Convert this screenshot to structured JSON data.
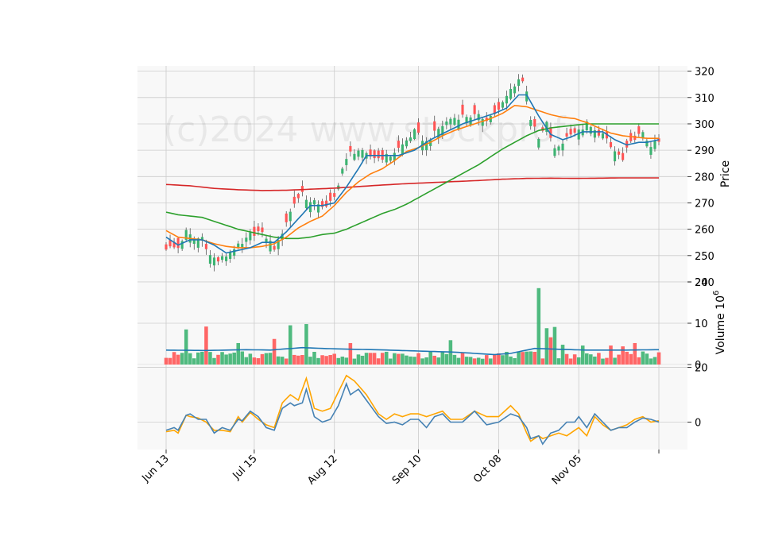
{
  "chart_data": {
    "type": "candlestick",
    "watermark": "(c)2024 www.stockprof",
    "x_tick_labels": [
      "Jun 13",
      "Jul 15",
      "Aug 12",
      "Sep 10",
      "Oct 08",
      "Nov 05",
      ""
    ],
    "x_tick_index": [
      0,
      22,
      42,
      63,
      83,
      103,
      123
    ],
    "colors": {
      "up": "#3cb371",
      "down": "#ff5555",
      "ma_short": "#1f77b4",
      "ma_mid": "#ff7f0e",
      "ma_long": "#2ca02c",
      "ma_200": "#d62728",
      "vol_avg": "#1f77b4",
      "osc_1": "#4682b4",
      "osc_2": "#ffa500",
      "panel_bg": "#f8f8f8",
      "grid": "#cccccc"
    },
    "price_panel": {
      "ylabel": "Price",
      "ylim": [
        240,
        322
      ],
      "yticks": [
        240,
        250,
        260,
        270,
        280,
        290,
        300,
        310,
        320
      ],
      "ohlc_anchors": [
        [
          0,
          253
        ],
        [
          3,
          253
        ],
        [
          5,
          259
        ],
        [
          7,
          256
        ],
        [
          9,
          257
        ],
        [
          11,
          250
        ],
        [
          13,
          248
        ],
        [
          15,
          250
        ],
        [
          17,
          253
        ],
        [
          19,
          254
        ],
        [
          21,
          258
        ],
        [
          23,
          259
        ],
        [
          25,
          257
        ],
        [
          27,
          253
        ],
        [
          28,
          255
        ],
        [
          30,
          263
        ],
        [
          32,
          270
        ],
        [
          34,
          274
        ],
        [
          36,
          270
        ],
        [
          38,
          270
        ],
        [
          40,
          268
        ],
        [
          42,
          272
        ],
        [
          44,
          283
        ],
        [
          46,
          289
        ],
        [
          48,
          290
        ],
        [
          50,
          288
        ],
        [
          53,
          287
        ],
        [
          56,
          288
        ],
        [
          59,
          292
        ],
        [
          62,
          297
        ],
        [
          65,
          293
        ],
        [
          68,
          298
        ],
        [
          71,
          302
        ],
        [
          74,
          303
        ],
        [
          77,
          303
        ],
        [
          80,
          302
        ],
        [
          83,
          305
        ],
        [
          86,
          313
        ],
        [
          88,
          317
        ],
        [
          89,
          316
        ],
        [
          90,
          313
        ],
        [
          91,
          302
        ],
        [
          93,
          294
        ],
        [
          95,
          300
        ],
        [
          97,
          290
        ],
        [
          99,
          293
        ],
        [
          101,
          297
        ],
        [
          103,
          297
        ],
        [
          105,
          300
        ],
        [
          107,
          297
        ],
        [
          109,
          296
        ],
        [
          111,
          291
        ],
        [
          113,
          288
        ],
        [
          114,
          286
        ],
        [
          115,
          290
        ],
        [
          117,
          295
        ],
        [
          119,
          296
        ],
        [
          121,
          292
        ],
        [
          123,
          293
        ]
      ],
      "ma_short_anchors": [
        [
          0,
          257
        ],
        [
          3,
          254
        ],
        [
          6,
          256
        ],
        [
          9,
          256
        ],
        [
          12,
          254
        ],
        [
          15,
          251
        ],
        [
          18,
          252
        ],
        [
          21,
          253
        ],
        [
          24,
          255
        ],
        [
          27,
          255
        ],
        [
          30,
          259
        ],
        [
          33,
          264
        ],
        [
          36,
          269
        ],
        [
          39,
          269
        ],
        [
          42,
          270
        ],
        [
          45,
          276
        ],
        [
          48,
          283
        ],
        [
          50,
          288
        ],
        [
          54,
          288
        ],
        [
          58,
          288
        ],
        [
          62,
          290
        ],
        [
          66,
          294
        ],
        [
          70,
          297
        ],
        [
          74,
          300
        ],
        [
          78,
          302
        ],
        [
          82,
          304
        ],
        [
          85,
          306
        ],
        [
          88,
          311
        ],
        [
          90,
          311
        ],
        [
          93,
          303
        ],
        [
          96,
          296
        ],
        [
          99,
          294
        ],
        [
          101,
          295
        ],
        [
          104,
          297
        ],
        [
          106,
          297
        ],
        [
          109,
          297
        ],
        [
          112,
          294
        ],
        [
          115,
          292
        ],
        [
          118,
          293
        ],
        [
          120,
          293
        ],
        [
          123,
          294
        ]
      ],
      "ma_mid_anchors": [
        [
          0,
          259.5
        ],
        [
          3,
          257
        ],
        [
          6,
          256.5
        ],
        [
          9,
          256
        ],
        [
          12,
          254.5
        ],
        [
          15,
          253.5
        ],
        [
          18,
          253
        ],
        [
          21,
          253
        ],
        [
          24,
          253.5
        ],
        [
          27,
          254.5
        ],
        [
          30,
          257
        ],
        [
          33,
          260.5
        ],
        [
          36,
          263
        ],
        [
          39,
          265
        ],
        [
          42,
          269
        ],
        [
          45,
          274
        ],
        [
          48,
          278
        ],
        [
          51,
          281
        ],
        [
          54,
          283
        ],
        [
          57,
          286
        ],
        [
          60,
          289.5
        ],
        [
          63,
          291
        ],
        [
          66,
          293
        ],
        [
          69,
          295.5
        ],
        [
          72,
          297.5
        ],
        [
          75,
          299
        ],
        [
          78,
          300.5
        ],
        [
          81,
          302
        ],
        [
          84,
          304
        ],
        [
          87,
          307
        ],
        [
          90,
          306.5
        ],
        [
          93,
          305
        ],
        [
          96,
          303.5
        ],
        [
          99,
          302.5
        ],
        [
          102,
          302
        ],
        [
          105,
          300.5
        ],
        [
          108,
          298.5
        ],
        [
          111,
          296.5
        ],
        [
          114,
          295.5
        ],
        [
          117,
          295
        ],
        [
          120,
          294.5
        ],
        [
          123,
          294.5
        ]
      ],
      "ma_long_anchors": [
        [
          0,
          266.5
        ],
        [
          3,
          265.5
        ],
        [
          6,
          265
        ],
        [
          9,
          264.5
        ],
        [
          12,
          263
        ],
        [
          15,
          261.5
        ],
        [
          18,
          260
        ],
        [
          21,
          259
        ],
        [
          24,
          258
        ],
        [
          27,
          257
        ],
        [
          30,
          256.5
        ],
        [
          33,
          256.5
        ],
        [
          36,
          257
        ],
        [
          39,
          258
        ],
        [
          42,
          258.5
        ],
        [
          45,
          260
        ],
        [
          48,
          262
        ],
        [
          51,
          264
        ],
        [
          54,
          266
        ],
        [
          57,
          267.5
        ],
        [
          60,
          269.5
        ],
        [
          63,
          272
        ],
        [
          66,
          274.5
        ],
        [
          69,
          277
        ],
        [
          72,
          279.5
        ],
        [
          75,
          282
        ],
        [
          78,
          284.5
        ],
        [
          81,
          287.5
        ],
        [
          84,
          290.5
        ],
        [
          87,
          293
        ],
        [
          90,
          295.5
        ],
        [
          93,
          297.5
        ],
        [
          96,
          298.5
        ],
        [
          99,
          299
        ],
        [
          102,
          299.5
        ],
        [
          105,
          300
        ],
        [
          108,
          300
        ],
        [
          111,
          300
        ],
        [
          114,
          300
        ],
        [
          117,
          300
        ],
        [
          120,
          300
        ],
        [
          123,
          300
        ]
      ],
      "ma_200_anchors": [
        [
          0,
          277
        ],
        [
          6,
          276.5
        ],
        [
          12,
          275.5
        ],
        [
          18,
          275
        ],
        [
          24,
          274.7
        ],
        [
          30,
          274.8
        ],
        [
          36,
          275.2
        ],
        [
          42,
          275.6
        ],
        [
          48,
          276.2
        ],
        [
          54,
          276.8
        ],
        [
          60,
          277.3
        ],
        [
          66,
          277.7
        ],
        [
          72,
          278.1
        ],
        [
          78,
          278.5
        ],
        [
          84,
          279
        ],
        [
          90,
          279.3
        ],
        [
          96,
          279.4
        ],
        [
          102,
          279.3
        ],
        [
          108,
          279.4
        ],
        [
          114,
          279.5
        ],
        [
          123,
          279.5
        ]
      ]
    },
    "volume_panel": {
      "ylabel": "Volume  10^6",
      "ylim": [
        0,
        20
      ],
      "yticks": [
        0,
        10,
        20
      ],
      "avg_anchors": [
        [
          0,
          3.5
        ],
        [
          10,
          3.4
        ],
        [
          20,
          3.6
        ],
        [
          26,
          3.5
        ],
        [
          34,
          4.1
        ],
        [
          42,
          3.8
        ],
        [
          52,
          3.6
        ],
        [
          62,
          3.3
        ],
        [
          72,
          3.0
        ],
        [
          82,
          2.4
        ],
        [
          86,
          2.7
        ],
        [
          92,
          3.9
        ],
        [
          98,
          3.7
        ],
        [
          105,
          3.5
        ],
        [
          115,
          3.5
        ],
        [
          123,
          3.6
        ]
      ],
      "spikes": [
        [
          5,
          8.5
        ],
        [
          10,
          9.2
        ],
        [
          18,
          5.2
        ],
        [
          27,
          6.2
        ],
        [
          31,
          9.5
        ],
        [
          35,
          9.8
        ],
        [
          46,
          5.2
        ],
        [
          71,
          5.9
        ],
        [
          93,
          18.5
        ],
        [
          95,
          8.8
        ],
        [
          96,
          6.6
        ],
        [
          97,
          9.1
        ],
        [
          99,
          4.8
        ],
        [
          104,
          4.6
        ],
        [
          111,
          4.6
        ],
        [
          114,
          4.4
        ],
        [
          117,
          5.2
        ]
      ]
    },
    "oscillator_panel": {
      "ylim": [
        -10,
        21
      ],
      "yticks": [
        0,
        20
      ],
      "series_1_anchors": [
        [
          0,
          -3
        ],
        [
          2,
          -2
        ],
        [
          3,
          -3
        ],
        [
          5,
          2.5
        ],
        [
          6,
          3
        ],
        [
          8,
          1
        ],
        [
          10,
          1
        ],
        [
          12,
          -4
        ],
        [
          14,
          -2
        ],
        [
          16,
          -3
        ],
        [
          18,
          1
        ],
        [
          19,
          0.5
        ],
        [
          21,
          4
        ],
        [
          23,
          2
        ],
        [
          25,
          -2
        ],
        [
          27,
          -3
        ],
        [
          29,
          5
        ],
        [
          31,
          7
        ],
        [
          32,
          6
        ],
        [
          34,
          7
        ],
        [
          35,
          12
        ],
        [
          37,
          2
        ],
        [
          39,
          0
        ],
        [
          41,
          1
        ],
        [
          43,
          6
        ],
        [
          45,
          14
        ],
        [
          46,
          10
        ],
        [
          48,
          12
        ],
        [
          50,
          8
        ],
        [
          53,
          2
        ],
        [
          55,
          -0.5
        ],
        [
          57,
          0
        ],
        [
          59,
          -1
        ],
        [
          61,
          1
        ],
        [
          63,
          1
        ],
        [
          65,
          -2
        ],
        [
          67,
          2
        ],
        [
          69,
          3
        ],
        [
          71,
          0
        ],
        [
          74,
          0
        ],
        [
          77,
          4
        ],
        [
          80,
          -1
        ],
        [
          83,
          0
        ],
        [
          86,
          3
        ],
        [
          88,
          2
        ],
        [
          90,
          -2
        ],
        [
          91,
          -6
        ],
        [
          93,
          -5
        ],
        [
          94,
          -8
        ],
        [
          96,
          -4
        ],
        [
          98,
          -3
        ],
        [
          100,
          0
        ],
        [
          102,
          0
        ],
        [
          103,
          2
        ],
        [
          105,
          -2
        ],
        [
          107,
          3
        ],
        [
          109,
          0
        ],
        [
          111,
          -3
        ],
        [
          113,
          -2
        ],
        [
          115,
          -2
        ],
        [
          117,
          0
        ],
        [
          119,
          1.5
        ],
        [
          121,
          1
        ],
        [
          123,
          0
        ]
      ],
      "series_2_anchors": [
        [
          0,
          -3.5
        ],
        [
          2,
          -3
        ],
        [
          3,
          -4
        ],
        [
          5,
          2.5
        ],
        [
          6,
          2
        ],
        [
          8,
          1.5
        ],
        [
          10,
          0
        ],
        [
          12,
          -3
        ],
        [
          14,
          -3
        ],
        [
          16,
          -3.5
        ],
        [
          18,
          2
        ],
        [
          19,
          0
        ],
        [
          21,
          3.5
        ],
        [
          23,
          1
        ],
        [
          25,
          -1
        ],
        [
          27,
          -2
        ],
        [
          29,
          7
        ],
        [
          31,
          10
        ],
        [
          33,
          8
        ],
        [
          35,
          16
        ],
        [
          37,
          5
        ],
        [
          39,
          4
        ],
        [
          41,
          5
        ],
        [
          43,
          11
        ],
        [
          45,
          17
        ],
        [
          47,
          15
        ],
        [
          50,
          10
        ],
        [
          53,
          3
        ],
        [
          55,
          1
        ],
        [
          57,
          3
        ],
        [
          59,
          2
        ],
        [
          61,
          3
        ],
        [
          63,
          3
        ],
        [
          65,
          2
        ],
        [
          67,
          3
        ],
        [
          69,
          4
        ],
        [
          71,
          1
        ],
        [
          74,
          1
        ],
        [
          77,
          4
        ],
        [
          80,
          2
        ],
        [
          83,
          2
        ],
        [
          86,
          6
        ],
        [
          88,
          3
        ],
        [
          90,
          -4
        ],
        [
          91,
          -7
        ],
        [
          93,
          -5
        ],
        [
          94,
          -6
        ],
        [
          96,
          -5
        ],
        [
          98,
          -4
        ],
        [
          100,
          -5
        ],
        [
          102,
          -3
        ],
        [
          103,
          -2
        ],
        [
          105,
          -5
        ],
        [
          107,
          2
        ],
        [
          109,
          -1
        ],
        [
          111,
          -3
        ],
        [
          113,
          -2
        ],
        [
          115,
          -1
        ],
        [
          117,
          1
        ],
        [
          119,
          2
        ],
        [
          121,
          0
        ],
        [
          123,
          0.5
        ]
      ]
    }
  }
}
